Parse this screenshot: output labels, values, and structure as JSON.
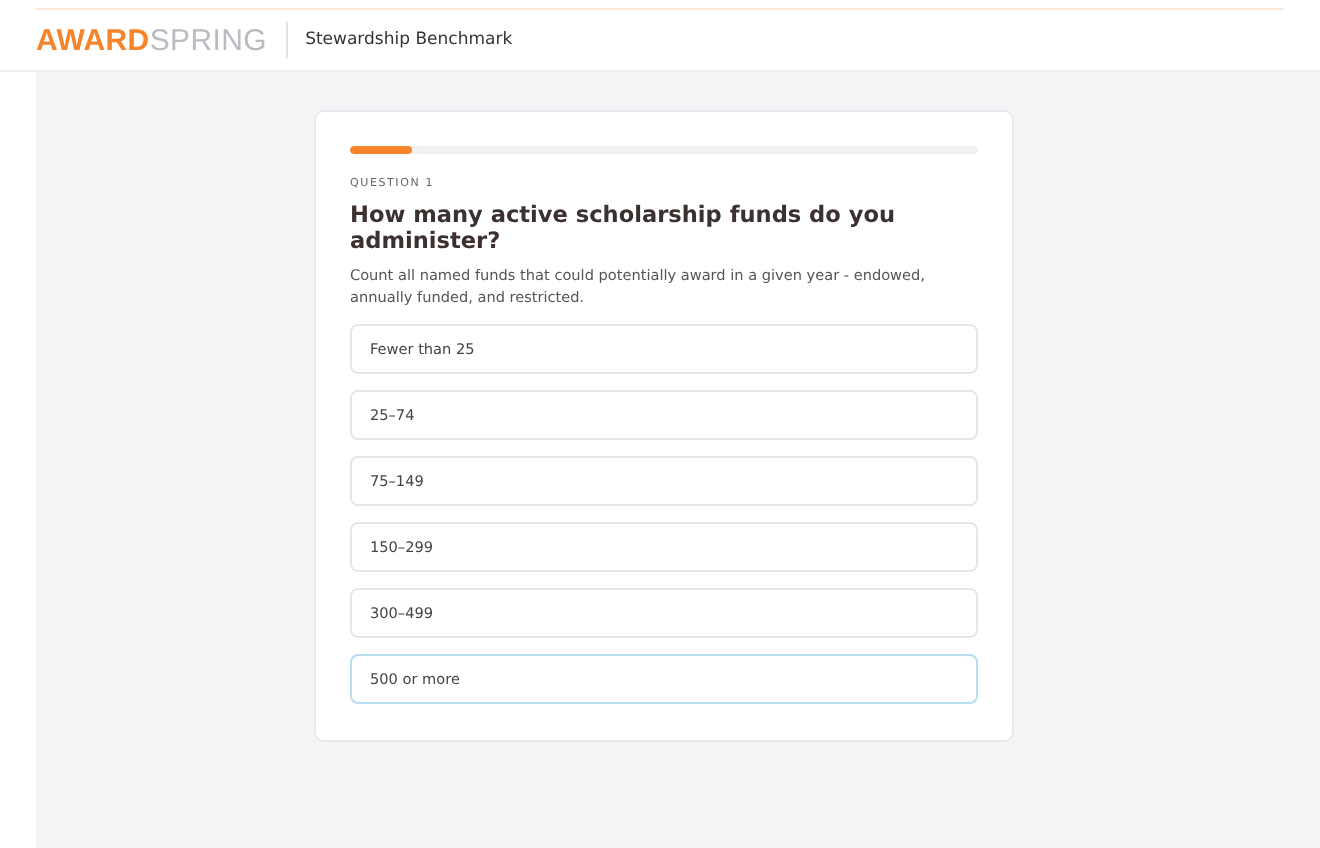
{
  "header": {
    "logo": "**AWARD**SPRING",
    "title": "Stewardship Benchmark"
  },
  "progress": {
    "level": 0.1
  },
  "question": {
    "label": "QUESTION 1",
    "title": "How many active scholarship funds do you administer?",
    "description": "Count all named funds that could potentially award in a given year - endowed, annually funded, and restricted."
  },
  "options": [
    {
      "label": "Fewer than 25",
      "selected": false
    },
    {
      "label": "25–74",
      "selected": false
    },
    {
      "label": "75–149",
      "selected": false
    },
    {
      "label": "150–299",
      "selected": false
    },
    {
      "label": "300–499",
      "selected": false
    },
    {
      "label": "500 or more",
      "selected": true
    }
  ]
}
